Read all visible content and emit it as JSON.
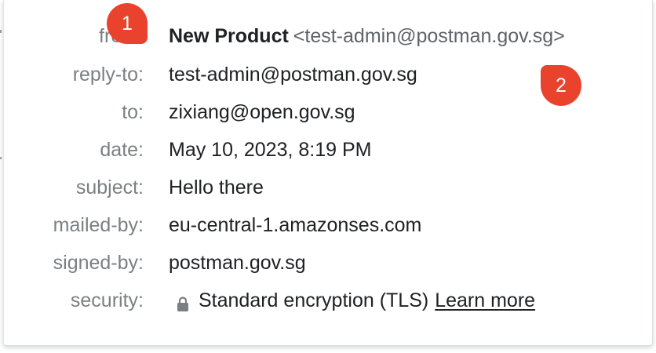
{
  "details": {
    "from": {
      "label": "from:",
      "name": "New Product",
      "email": "<test-admin@postman.gov.sg>"
    },
    "reply_to": {
      "label": "reply-to:",
      "value": "test-admin@postman.gov.sg"
    },
    "to": {
      "label": "to:",
      "value": "zixiang@open.gov.sg"
    },
    "date": {
      "label": "date:",
      "value": "May 10, 2023, 8:19 PM"
    },
    "subject": {
      "label": "subject:",
      "value": "Hello there"
    },
    "mailed_by": {
      "label": "mailed-by:",
      "value": "eu-central-1.amazonses.com"
    },
    "signed_by": {
      "label": "signed-by:",
      "value": "postman.gov.sg"
    },
    "security": {
      "label": "security:",
      "icon": "lock-icon",
      "value": "Standard encryption (TLS)",
      "link": "Learn more"
    }
  },
  "annotations": {
    "marker_1": "1",
    "marker_2": "2"
  },
  "colors": {
    "label": "#7b7f84",
    "value": "#202124",
    "email_secondary": "#5f6368",
    "marker": "#e9432e"
  }
}
